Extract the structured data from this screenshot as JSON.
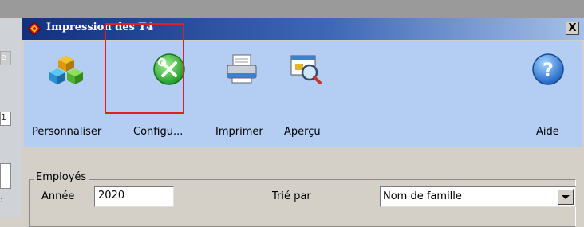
{
  "window": {
    "title": "Impression des T4",
    "close_label": "X"
  },
  "toolbar": {
    "items": [
      {
        "label": "Personnaliser",
        "icon": "personalize-icon"
      },
      {
        "label": "Configu...",
        "icon": "configure-tools-icon"
      },
      {
        "label": "Imprimer",
        "icon": "printer-icon"
      },
      {
        "label": "Aperçu",
        "icon": "preview-icon"
      },
      {
        "label": "Aide",
        "icon": "help-icon"
      }
    ],
    "background": "#b3cdf3"
  },
  "employees": {
    "group_title": "Employés",
    "year_label": "Année",
    "year_value": "2020",
    "sort_label": "Trié par",
    "sort_value": "Nom de famille"
  },
  "colors": {
    "highlight": "#e02020",
    "title_gradient_start": "#12307e",
    "title_gradient_end": "#a6c0e8"
  },
  "background_fragments": [
    "e",
    "1",
    ":"
  ]
}
